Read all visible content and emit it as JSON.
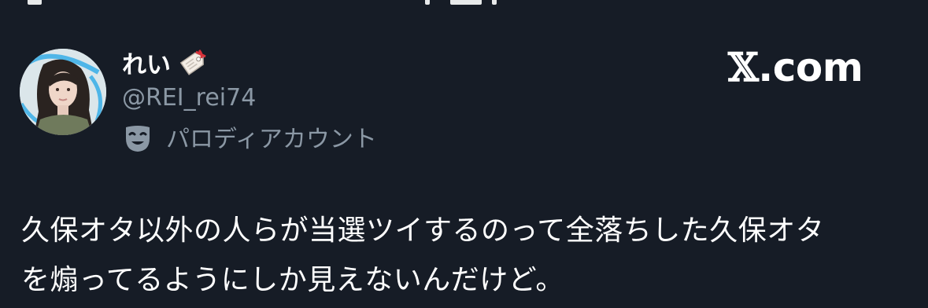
{
  "tweet": {
    "display_name": "れい",
    "name_emoji": "label-tag-icon",
    "handle": "@REI_rei74",
    "account_label": "パロディアカウント",
    "account_label_icon": "theater-mask-icon",
    "text_line1": "久保オタ以外の人らが当選ツイするのって全落ちした久保オタ",
    "text_line2": "を煽ってるようにしか見えないんだけど。"
  },
  "brand": {
    "site_x": "𝕏",
    "site_suffix": ".com"
  },
  "colors": {
    "background": "#161c26",
    "primary_text": "#ffffff",
    "secondary_text": "#8b98a5"
  }
}
